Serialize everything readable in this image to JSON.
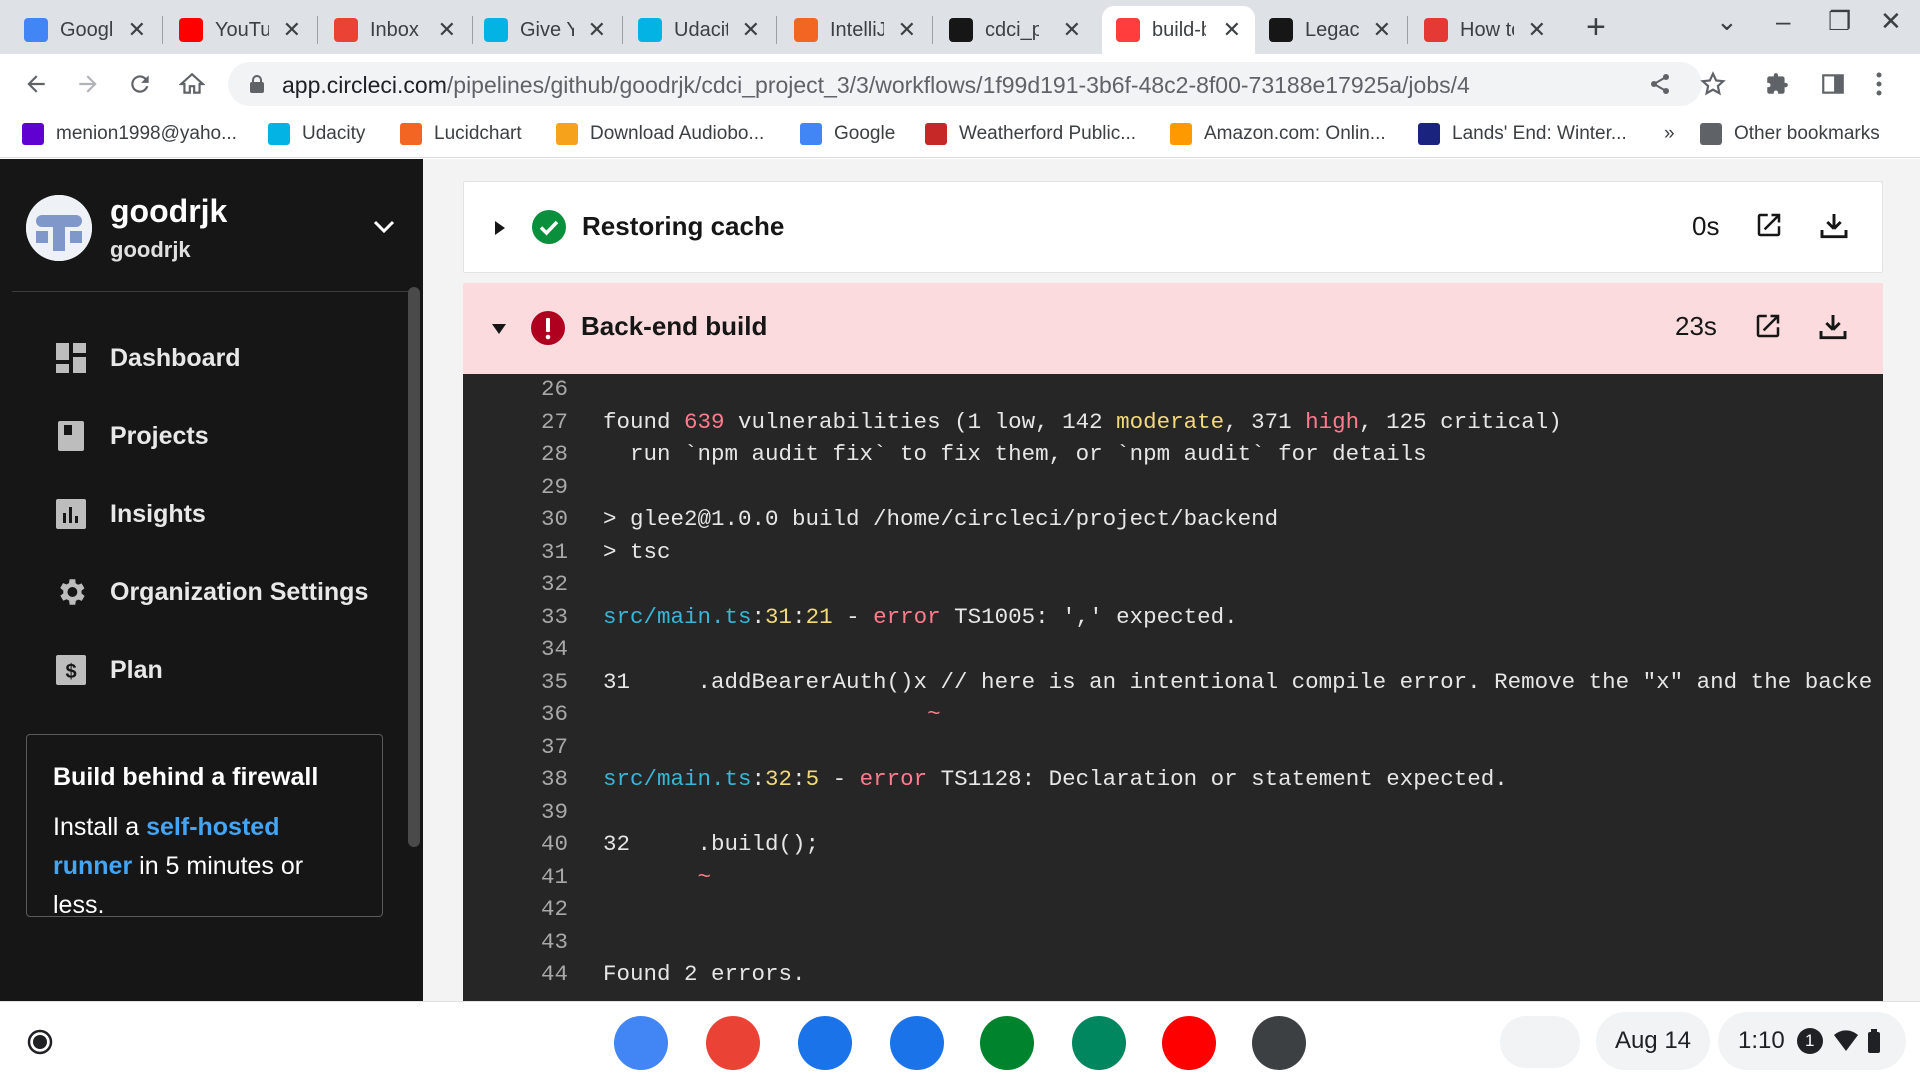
{
  "tabs": [
    {
      "title": "Google",
      "icon": "google-icon",
      "color": "#4285f4"
    },
    {
      "title": "YouTube",
      "icon": "youtube-icon",
      "color": "#ff0000"
    },
    {
      "title": "Inbox",
      "icon": "gmail-icon",
      "color": "#ea4335"
    },
    {
      "title": "Give Your",
      "icon": "udacity-icon",
      "color": "#02b3e4"
    },
    {
      "title": "Udacity",
      "icon": "udacity-icon",
      "color": "#02b3e4"
    },
    {
      "title": "IntelliJ",
      "icon": "intellij-icon",
      "color": "#f26522"
    },
    {
      "title": "cdci_project",
      "icon": "github-icon",
      "color": "#161616"
    },
    {
      "title": "build-backend",
      "icon": "circleci-icon",
      "color": "#ff3d3d"
    },
    {
      "title": "Legacy",
      "icon": "circleci-icon",
      "color": "#161616"
    },
    {
      "title": "How to",
      "icon": "c-icon",
      "color": "#e53935"
    }
  ],
  "url": {
    "domain": "app.circleci.com",
    "path": "/pipelines/github/goodrjk/cdci_project_3/3/workflows/1f99d191-3b6f-48c2-8f00-73188e17925a/jobs/4"
  },
  "bookmarks": [
    {
      "label": "menion1998@yaho...",
      "icon": "yahoo-icon",
      "color": "#6001d2"
    },
    {
      "label": "Udacity",
      "icon": "udacity-icon",
      "color": "#02b3e4"
    },
    {
      "label": "Lucidchart",
      "icon": "lucidchart-icon",
      "color": "#f26522"
    },
    {
      "label": "Download Audiobo...",
      "icon": "audiobooks-icon",
      "color": "#f7a21b"
    },
    {
      "label": "Google",
      "icon": "google-icon",
      "color": "#4285f4"
    },
    {
      "label": "Weatherford Public...",
      "icon": "library-icon",
      "color": "#c62828"
    },
    {
      "label": "Amazon.com: Onlin...",
      "icon": "amazon-icon",
      "color": "#ff9900"
    },
    {
      "label": "Lands' End: Winter...",
      "icon": "landsend-icon",
      "color": "#1a237e"
    }
  ],
  "bookmarks_more": "»",
  "other_bookmarks": "Other bookmarks",
  "sidebar": {
    "org_name": "goodrjk",
    "org_sub": "goodrjk",
    "nav": [
      {
        "label": "Dashboard",
        "icon": "dashboard-icon"
      },
      {
        "label": "Projects",
        "icon": "projects-icon"
      },
      {
        "label": "Insights",
        "icon": "insights-icon"
      },
      {
        "label": "Organization Settings",
        "icon": "gear-icon"
      },
      {
        "label": "Plan",
        "icon": "dollar-icon"
      }
    ],
    "promo": {
      "title": "Build behind a firewall",
      "text_before": "Install a ",
      "link": "self-hosted runner",
      "text_after": " in 5 minutes or less."
    }
  },
  "steps": [
    {
      "name": "Restoring cache",
      "duration": "0s",
      "status": "success"
    },
    {
      "name": "Back-end build",
      "duration": "23s",
      "status": "failed"
    }
  ],
  "terminal": [
    {
      "n": "26",
      "parts": [
        {
          "t": ""
        }
      ]
    },
    {
      "n": "27",
      "parts": [
        {
          "t": "found "
        },
        {
          "t": "639",
          "c": "pk"
        },
        {
          "t": " vulnerabilities (1 low, 142 "
        },
        {
          "t": "moderate",
          "c": "yl"
        },
        {
          "t": ", 371 "
        },
        {
          "t": "high",
          "c": "pk"
        },
        {
          "t": ", 125 critical)"
        }
      ]
    },
    {
      "n": "28",
      "parts": [
        {
          "t": "  run `npm audit fix` to fix them, or `npm audit` for details"
        }
      ]
    },
    {
      "n": "29",
      "parts": [
        {
          "t": ""
        }
      ]
    },
    {
      "n": "30",
      "parts": [
        {
          "t": "> glee2@1.0.0 build /home/circleci/project/backend"
        }
      ]
    },
    {
      "n": "31",
      "parts": [
        {
          "t": "> tsc"
        }
      ]
    },
    {
      "n": "32",
      "parts": [
        {
          "t": ""
        }
      ]
    },
    {
      "n": "33",
      "parts": [
        {
          "t": "src/main.ts",
          "c": "cy"
        },
        {
          "t": ":"
        },
        {
          "t": "31",
          "c": "yl"
        },
        {
          "t": ":"
        },
        {
          "t": "21",
          "c": "yl"
        },
        {
          "t": " - "
        },
        {
          "t": "error",
          "c": "pk"
        },
        {
          "t": " TS1005: ',' expected."
        }
      ]
    },
    {
      "n": "34",
      "parts": [
        {
          "t": ""
        }
      ]
    },
    {
      "n": "35",
      "parts": [
        {
          "t": "31     .addBearerAuth()x // here is an intentional compile error. Remove the \"x\" and the backe"
        }
      ]
    },
    {
      "n": "36",
      "parts": [
        {
          "t": "                        "
        },
        {
          "t": "~",
          "c": "pk"
        }
      ]
    },
    {
      "n": "37",
      "parts": [
        {
          "t": ""
        }
      ]
    },
    {
      "n": "38",
      "parts": [
        {
          "t": "src/main.ts",
          "c": "cy"
        },
        {
          "t": ":"
        },
        {
          "t": "32",
          "c": "yl"
        },
        {
          "t": ":"
        },
        {
          "t": "5",
          "c": "yl"
        },
        {
          "t": " - "
        },
        {
          "t": "error",
          "c": "pk"
        },
        {
          "t": " TS1128: Declaration or statement expected."
        }
      ]
    },
    {
      "n": "39",
      "parts": [
        {
          "t": ""
        }
      ]
    },
    {
      "n": "40",
      "parts": [
        {
          "t": "32     .build();"
        }
      ]
    },
    {
      "n": "41",
      "parts": [
        {
          "t": "       "
        },
        {
          "t": "~",
          "c": "pk"
        }
      ]
    },
    {
      "n": "42",
      "parts": [
        {
          "t": ""
        }
      ]
    },
    {
      "n": "43",
      "parts": [
        {
          "t": ""
        }
      ]
    },
    {
      "n": "44",
      "parts": [
        {
          "t": "Found 2 errors."
        }
      ]
    }
  ],
  "shelf": {
    "apps": [
      {
        "name": "chrome-icon",
        "color": "#4285f4"
      },
      {
        "name": "gmail-icon",
        "color": "#ea4335"
      },
      {
        "name": "files-icon",
        "color": "#1a73e8"
      },
      {
        "name": "messages-icon",
        "color": "#1a73e8"
      },
      {
        "name": "meet-icon",
        "color": "#00832d"
      },
      {
        "name": "play-store-icon",
        "color": "#01875f"
      },
      {
        "name": "youtube-icon",
        "color": "#ff0000"
      },
      {
        "name": "terminal-icon",
        "color": "#3c4043"
      }
    ],
    "date": "Aug 14",
    "time": "1:10",
    "notification_count": "1"
  }
}
